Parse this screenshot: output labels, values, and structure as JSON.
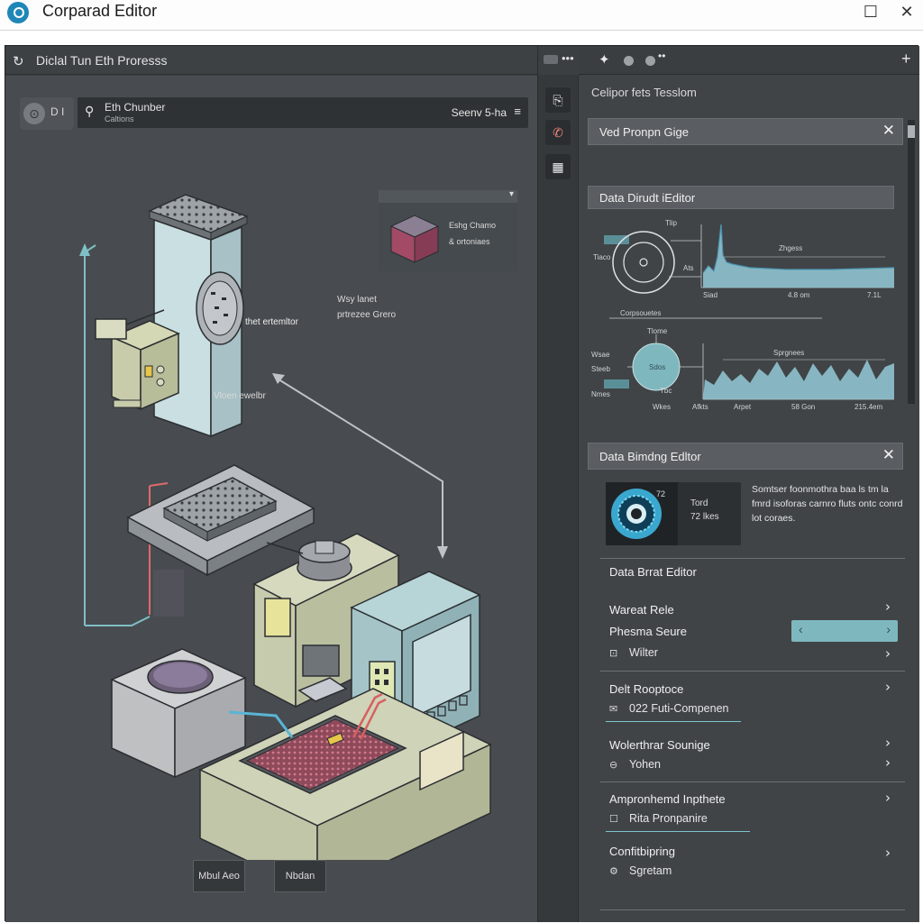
{
  "window": {
    "title": "Corparad Editor",
    "maximize_icon": "☐",
    "close_icon": "✕"
  },
  "canvas": {
    "header_title": "Diclal Tun Eth Proresss",
    "zoom_label": "D I",
    "chamber": {
      "name": "Eth Chunber",
      "sub": "Caltions",
      "status": "Seenv 5-ha"
    },
    "labels": {
      "vacuum": "Vloen ewelbr",
      "heat_controller": "thet ertemltor",
      "way_lower": "Wsy lanet",
      "pressure": "prtrezee Grero"
    },
    "wafer_preview": {
      "line1": "Eshg Chamo",
      "line2": "& ortoniaes"
    },
    "buttons": {
      "mini": "Mbul Aeo",
      "niobian": "Nbdan"
    }
  },
  "right": {
    "heading": "Celipor fets Tesslom",
    "section1_title": "Ved Pronpn Gige",
    "section2_title": "Data Dirudt iEditor",
    "chart": {
      "ring_label_top": "Tlip",
      "ring_label_left": "Tiaco",
      "ring_label_right": "Ats",
      "line_label": "Zhgess",
      "x_ticks": [
        "Siad",
        "4.8 om",
        "7.1L"
      ],
      "subtitle": "Corpsouetes",
      "node_top": "Tlome",
      "node_text": "Sdos",
      "node_left1": "Wsae",
      "node_left2": "Steeb",
      "node_left3": "Nmes",
      "node_bottom": "Tbc",
      "area_label": "Sprgnees",
      "x_ticks2": [
        "Wkes",
        "Afkts",
        "Arpet",
        "58 Gon",
        "215.4em"
      ]
    },
    "section3_title": "Data Bimdng Edltor",
    "binding": {
      "val1": "Tord",
      "val2": "72 lkes",
      "tag": "72",
      "desc": "Somtser foonmothra baa ls tm la fmrd isoforas carnro fluts ontc conrd lot coraes."
    },
    "brat_title": "Data Brrat Editor",
    "rows": {
      "wareat": "Wareat Rele",
      "phesma": "Phesma Seure",
      "wiiter": "Wilter",
      "delt": "Delt Rooptoce",
      "delt_sub": "022 Futi-Compenen",
      "woler": "Wolerthrar Sounige",
      "woler_sub": "Yohen",
      "ampro": "Ampronhemd Inpthete",
      "ampro_sub": "Rita Pronpanire",
      "confi": "Confitbipring",
      "confi_sub": "Sgretam"
    }
  },
  "colors": {
    "accent": "#7fb7be",
    "chart_fill": "#8fc3cf",
    "panel_bg": "#404447"
  }
}
